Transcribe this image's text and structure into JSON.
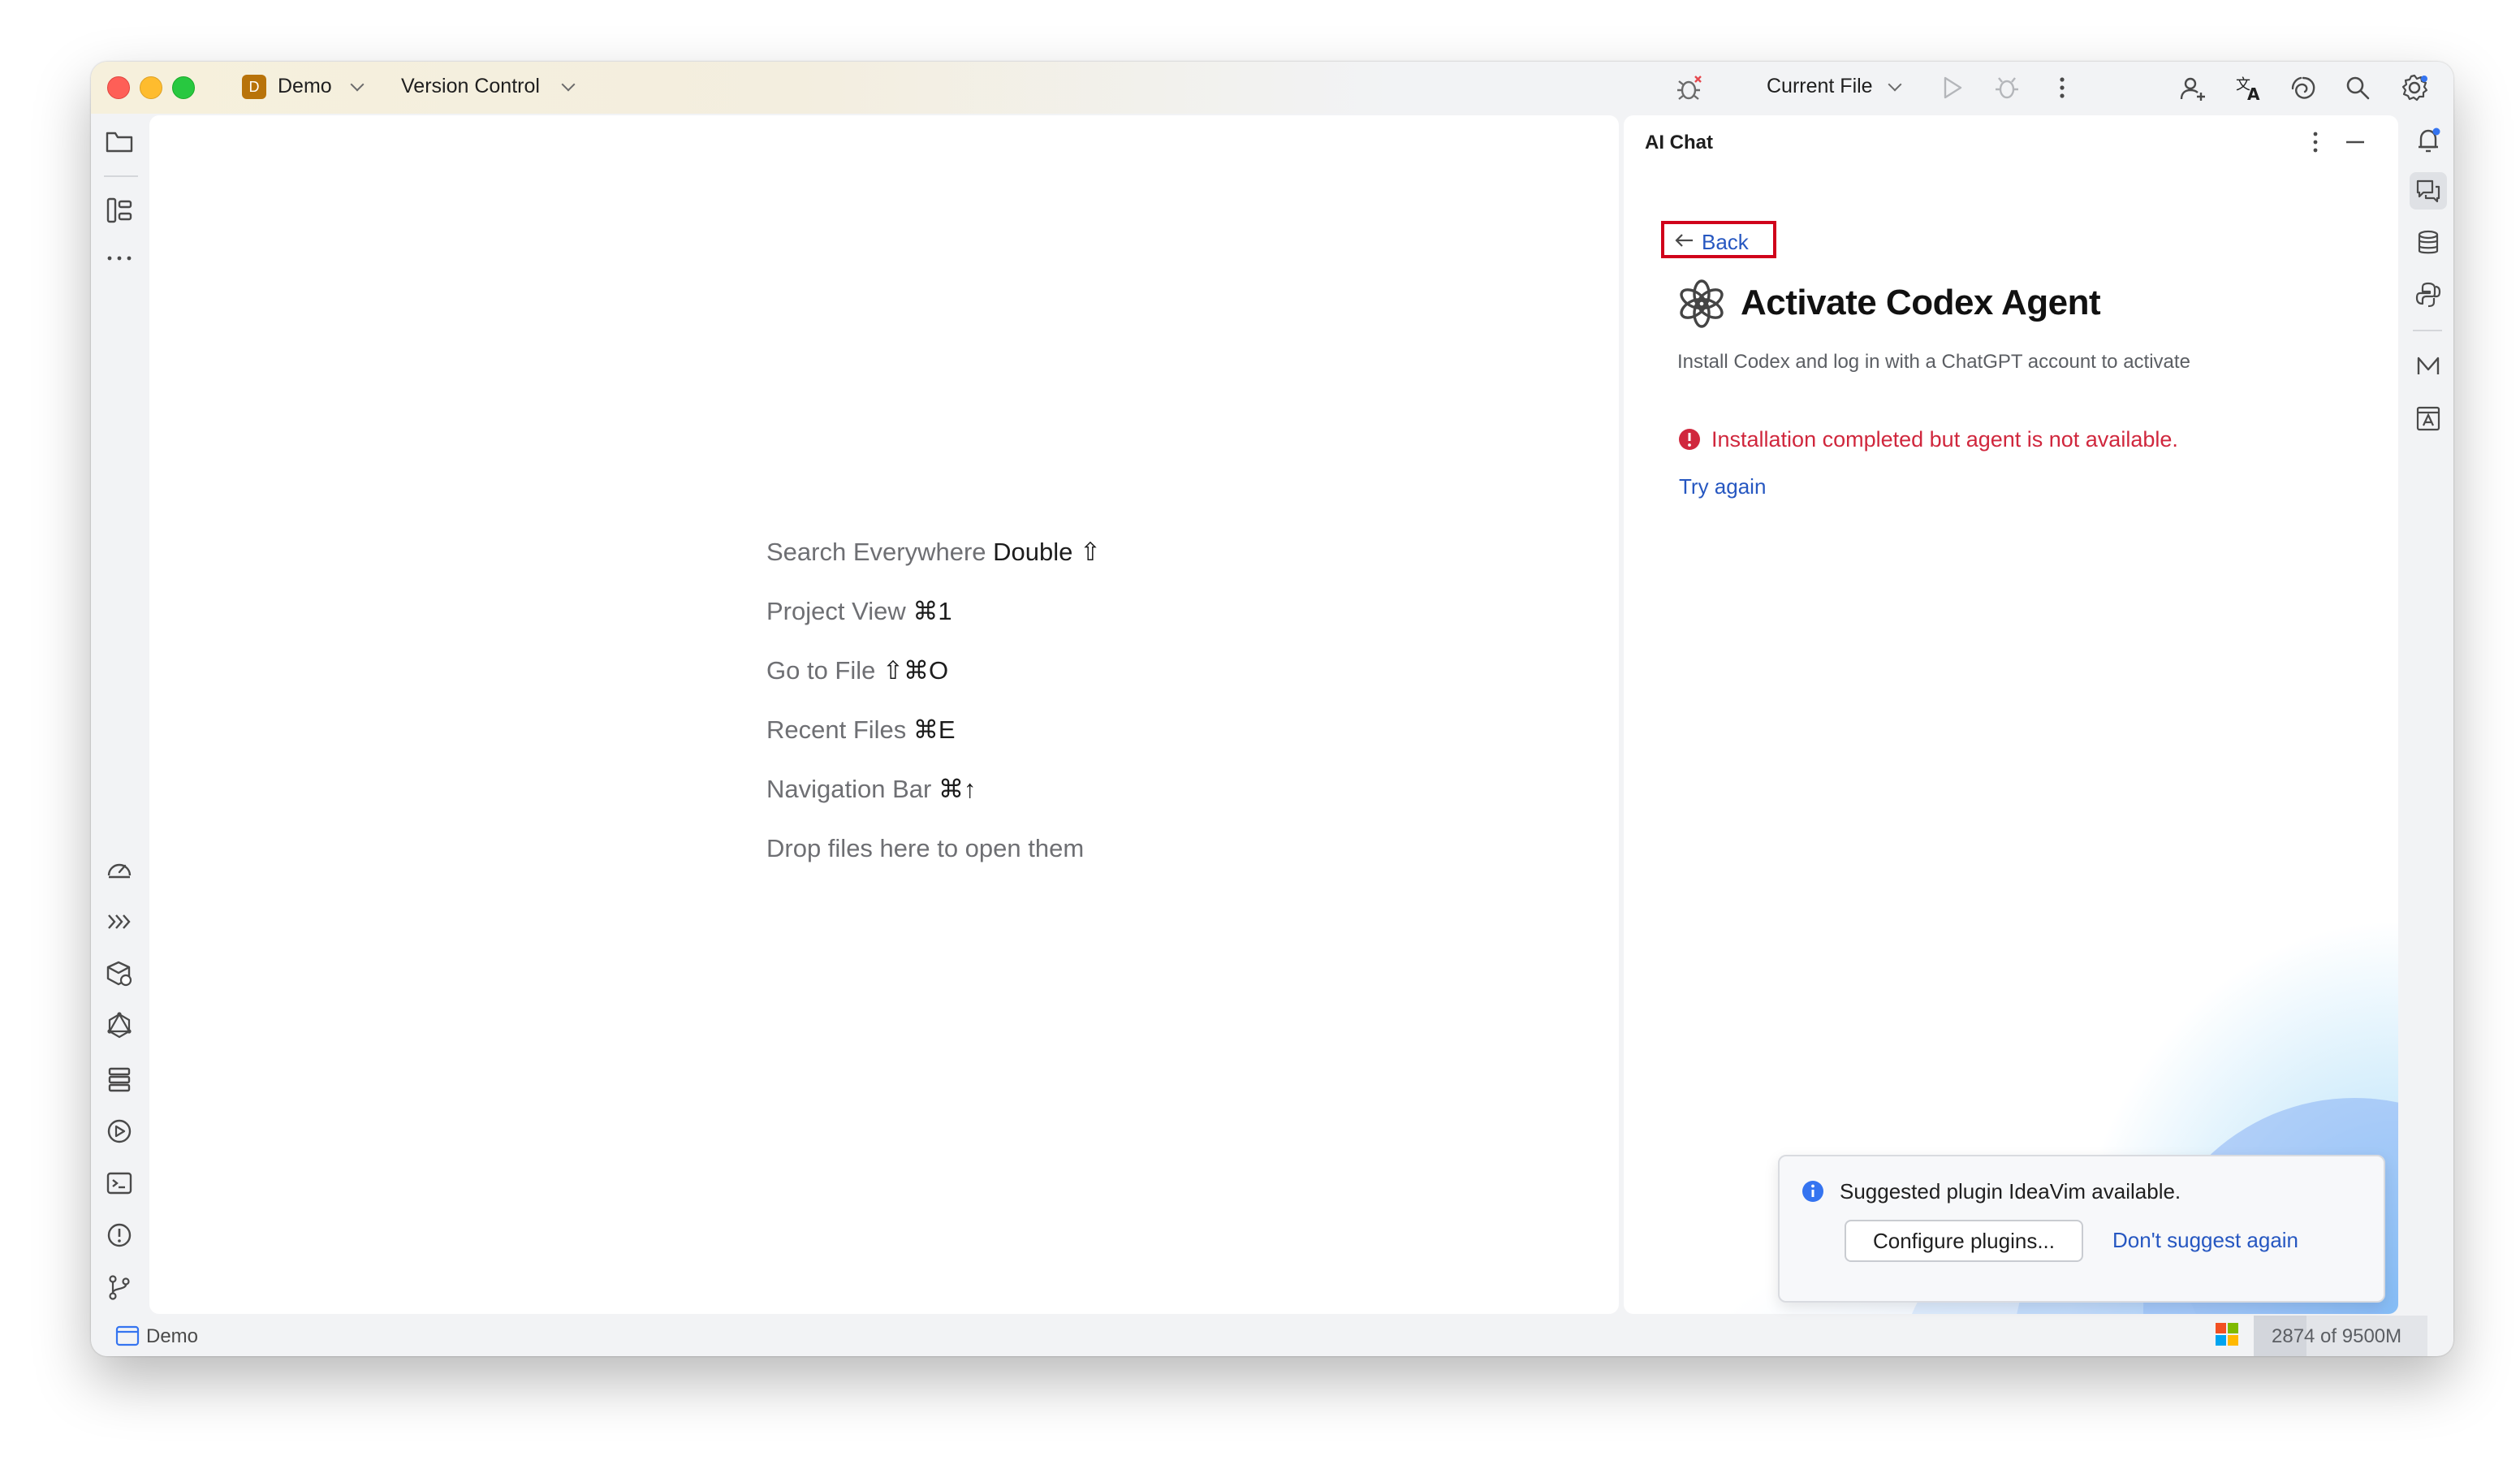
{
  "titlebar": {
    "project_badge": "D",
    "project_name": "Demo",
    "vcs_label": "Version Control",
    "run_config": "Current File"
  },
  "editor": {
    "hints": [
      {
        "label": "Search Everywhere",
        "key": "Double ⇧"
      },
      {
        "label": "Project View",
        "key": "⌘1"
      },
      {
        "label": "Go to File",
        "key": "⇧⌘O"
      },
      {
        "label": "Recent Files",
        "key": "⌘E"
      },
      {
        "label": "Navigation Bar",
        "key": "⌘↑"
      },
      {
        "label": "Drop files here to open them",
        "key": ""
      }
    ]
  },
  "chat": {
    "panel_title": "AI Chat",
    "back_label": "Back",
    "heading": "Activate Codex Agent",
    "subtitle": "Install Codex and log in with a ChatGPT account to activate",
    "error_message": "Installation completed but agent is not available.",
    "retry_label": "Try again"
  },
  "notification": {
    "message": "Suggested plugin IdeaVim available.",
    "configure_label": "Configure plugins...",
    "dismiss_label": "Don't suggest again"
  },
  "statusbar": {
    "project_name": "Demo",
    "memory": "2874 of 9500M"
  },
  "colors": {
    "accent_link": "#2657c1",
    "error": "#d0273d",
    "highlight_box": "#d0021b",
    "project_badge": "#b8730a"
  }
}
